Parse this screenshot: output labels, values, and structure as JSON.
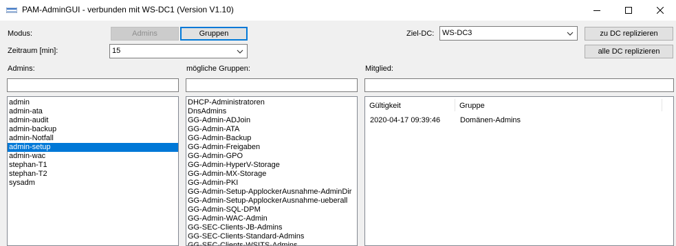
{
  "window": {
    "title": "PAM-AdminGUI - verbunden mit WS-DC1 (Version V1.10)"
  },
  "controls": {
    "modus_label": "Modus:",
    "admins_button": "Admins",
    "gruppen_button": "Gruppen",
    "zeitraum_label": "Zeitraum [min]:",
    "zeitraum_value": "15",
    "ziel_dc_label": "Ziel-DC:",
    "ziel_dc_value": "WS-DC3",
    "replicate_dc_button": "zu DC replizieren",
    "replicate_all_button": "alle DC replizieren"
  },
  "admins": {
    "label": "Admins:",
    "filter": "",
    "selected": "admin-setup",
    "items": [
      "admin",
      "admin-ata",
      "admin-audit",
      "admin-backup",
      "admin-Notfall",
      "admin-setup",
      "admin-wac",
      "stephan-T1",
      "stephan-T2",
      "sysadm"
    ]
  },
  "groups": {
    "label": "mögliche Gruppen:",
    "filter": "",
    "items": [
      "DHCP-Administratoren",
      "DnsAdmins",
      "GG-Admin-ADJoin",
      "GG-Admin-ATA",
      "GG-Admin-Backup",
      "GG-Admin-Freigaben",
      "GG-Admin-GPO",
      "GG-Admin-HyperV-Storage",
      "GG-Admin-MX-Storage",
      "GG-Admin-PKI",
      "GG-Admin-Setup-ApplockerAusnahme-AdminDir",
      "GG-Admin-Setup-ApplockerAusnahme-ueberall",
      "GG-Admin-SQL-DPM",
      "GG-Admin-WAC-Admin",
      "GG-SEC-Clients-JB-Admins",
      "GG-SEC-Clients-Standard-Admins",
      "GG-SEC-Clients-WSITS-Admins"
    ]
  },
  "membership": {
    "label": "Mitglied:",
    "filter": "",
    "columns": [
      "Gültigkeit",
      "Gruppe"
    ],
    "rows": [
      {
        "validity": "2020-04-17 09:39:46",
        "group": "Domänen-Admins"
      }
    ]
  }
}
